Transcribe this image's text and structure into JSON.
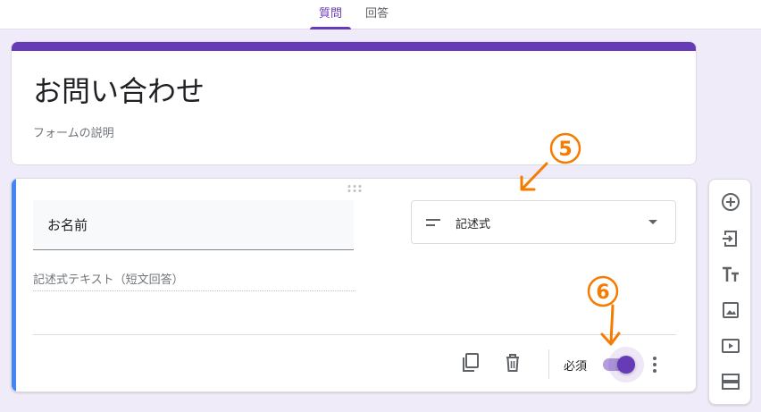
{
  "tabs": [
    {
      "label": "質問",
      "active": true
    },
    {
      "label": "回答",
      "active": false
    }
  ],
  "colors": {
    "accent": "#673ab7",
    "focus_bar": "#4285f4",
    "annotation": "#f57c00"
  },
  "form": {
    "title": "お問い合わせ",
    "description": "フォームの説明"
  },
  "question": {
    "title_value": "お名前",
    "type_label": "記述式",
    "answer_placeholder": "記述式テキスト（短文回答）",
    "required_label": "必須",
    "required_on": true
  },
  "annotations": [
    "⑤",
    "⑥"
  ],
  "icons": {
    "drag": "drag-handle-icon",
    "type": "short-text-icon",
    "copy": "copy-icon",
    "delete": "trash-icon",
    "more": "more-vert-icon",
    "tools": [
      "add-circle-icon",
      "import-icon",
      "title-text-icon",
      "image-icon",
      "video-icon",
      "section-icon"
    ]
  }
}
